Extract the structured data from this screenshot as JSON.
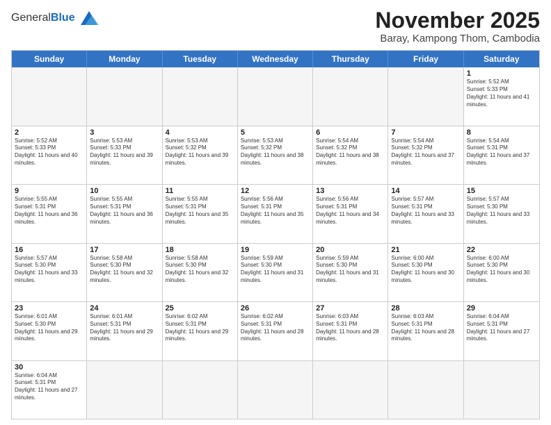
{
  "header": {
    "logo_general": "General",
    "logo_blue": "Blue",
    "month_title": "November 2025",
    "subtitle": "Baray, Kampong Thom, Cambodia"
  },
  "days_of_week": [
    "Sunday",
    "Monday",
    "Tuesday",
    "Wednesday",
    "Thursday",
    "Friday",
    "Saturday"
  ],
  "weeks": [
    [
      {
        "day": "",
        "info": ""
      },
      {
        "day": "",
        "info": ""
      },
      {
        "day": "",
        "info": ""
      },
      {
        "day": "",
        "info": ""
      },
      {
        "day": "",
        "info": ""
      },
      {
        "day": "",
        "info": ""
      },
      {
        "day": "1",
        "info": "Sunrise: 5:52 AM\nSunset: 5:33 PM\nDaylight: 11 hours and 41 minutes."
      }
    ],
    [
      {
        "day": "2",
        "info": "Sunrise: 5:52 AM\nSunset: 5:33 PM\nDaylight: 11 hours and 40 minutes."
      },
      {
        "day": "3",
        "info": "Sunrise: 5:53 AM\nSunset: 5:33 PM\nDaylight: 11 hours and 39 minutes."
      },
      {
        "day": "4",
        "info": "Sunrise: 5:53 AM\nSunset: 5:32 PM\nDaylight: 11 hours and 39 minutes."
      },
      {
        "day": "5",
        "info": "Sunrise: 5:53 AM\nSunset: 5:32 PM\nDaylight: 11 hours and 38 minutes."
      },
      {
        "day": "6",
        "info": "Sunrise: 5:54 AM\nSunset: 5:32 PM\nDaylight: 11 hours and 38 minutes."
      },
      {
        "day": "7",
        "info": "Sunrise: 5:54 AM\nSunset: 5:32 PM\nDaylight: 11 hours and 37 minutes."
      },
      {
        "day": "8",
        "info": "Sunrise: 5:54 AM\nSunset: 5:31 PM\nDaylight: 11 hours and 37 minutes."
      }
    ],
    [
      {
        "day": "9",
        "info": "Sunrise: 5:55 AM\nSunset: 5:31 PM\nDaylight: 11 hours and 36 minutes."
      },
      {
        "day": "10",
        "info": "Sunrise: 5:55 AM\nSunset: 5:31 PM\nDaylight: 11 hours and 36 minutes."
      },
      {
        "day": "11",
        "info": "Sunrise: 5:55 AM\nSunset: 5:31 PM\nDaylight: 11 hours and 35 minutes."
      },
      {
        "day": "12",
        "info": "Sunrise: 5:56 AM\nSunset: 5:31 PM\nDaylight: 11 hours and 35 minutes."
      },
      {
        "day": "13",
        "info": "Sunrise: 5:56 AM\nSunset: 5:31 PM\nDaylight: 11 hours and 34 minutes."
      },
      {
        "day": "14",
        "info": "Sunrise: 5:57 AM\nSunset: 5:31 PM\nDaylight: 11 hours and 33 minutes."
      },
      {
        "day": "15",
        "info": "Sunrise: 5:57 AM\nSunset: 5:30 PM\nDaylight: 11 hours and 33 minutes."
      }
    ],
    [
      {
        "day": "16",
        "info": "Sunrise: 5:57 AM\nSunset: 5:30 PM\nDaylight: 11 hours and 33 minutes."
      },
      {
        "day": "17",
        "info": "Sunrise: 5:58 AM\nSunset: 5:30 PM\nDaylight: 11 hours and 32 minutes."
      },
      {
        "day": "18",
        "info": "Sunrise: 5:58 AM\nSunset: 5:30 PM\nDaylight: 11 hours and 32 minutes."
      },
      {
        "day": "19",
        "info": "Sunrise: 5:59 AM\nSunset: 5:30 PM\nDaylight: 11 hours and 31 minutes."
      },
      {
        "day": "20",
        "info": "Sunrise: 5:59 AM\nSunset: 5:30 PM\nDaylight: 11 hours and 31 minutes."
      },
      {
        "day": "21",
        "info": "Sunrise: 6:00 AM\nSunset: 5:30 PM\nDaylight: 11 hours and 30 minutes."
      },
      {
        "day": "22",
        "info": "Sunrise: 6:00 AM\nSunset: 5:30 PM\nDaylight: 11 hours and 30 minutes."
      }
    ],
    [
      {
        "day": "23",
        "info": "Sunrise: 6:01 AM\nSunset: 5:30 PM\nDaylight: 11 hours and 29 minutes."
      },
      {
        "day": "24",
        "info": "Sunrise: 6:01 AM\nSunset: 5:31 PM\nDaylight: 11 hours and 29 minutes."
      },
      {
        "day": "25",
        "info": "Sunrise: 6:02 AM\nSunset: 5:31 PM\nDaylight: 11 hours and 29 minutes."
      },
      {
        "day": "26",
        "info": "Sunrise: 6:02 AM\nSunset: 5:31 PM\nDaylight: 11 hours and 28 minutes."
      },
      {
        "day": "27",
        "info": "Sunrise: 6:03 AM\nSunset: 5:31 PM\nDaylight: 11 hours and 28 minutes."
      },
      {
        "day": "28",
        "info": "Sunrise: 6:03 AM\nSunset: 5:31 PM\nDaylight: 11 hours and 28 minutes."
      },
      {
        "day": "29",
        "info": "Sunrise: 6:04 AM\nSunset: 5:31 PM\nDaylight: 11 hours and 27 minutes."
      }
    ],
    [
      {
        "day": "30",
        "info": "Sunrise: 6:04 AM\nSunset: 5:31 PM\nDaylight: 11 hours and 27 minutes."
      },
      {
        "day": "",
        "info": ""
      },
      {
        "day": "",
        "info": ""
      },
      {
        "day": "",
        "info": ""
      },
      {
        "day": "",
        "info": ""
      },
      {
        "day": "",
        "info": ""
      },
      {
        "day": "",
        "info": ""
      }
    ]
  ]
}
